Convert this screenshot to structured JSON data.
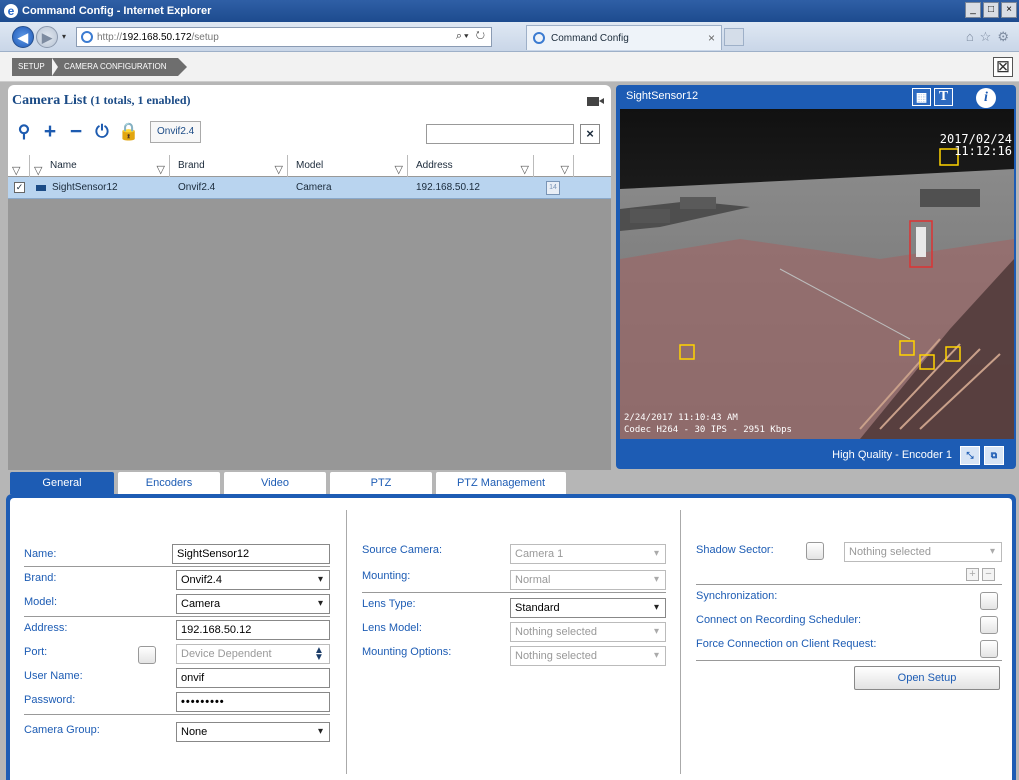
{
  "window": {
    "title": "Command Config - Internet Explorer",
    "controls": [
      "_",
      "□",
      "×"
    ]
  },
  "browser": {
    "url_proto": "http://",
    "url_host": "192.168.50.172",
    "url_path": "/setup",
    "url_controls": "⌕▾ ↻",
    "tab_title": "Command Config",
    "tab_close": "×",
    "nav_back": "◀",
    "nav_forward": "▶",
    "nav_dropdown": "▾",
    "right_icons": "⌂☆⚙"
  },
  "breadcrumb": {
    "items": [
      "SETUP",
      "CAMERA CONFIGURATION"
    ],
    "close": "⊠"
  },
  "camera_list": {
    "title": "Camera List",
    "subtitle": "(1 totals, 1 enabled)",
    "toolbar": {
      "search": "⚲",
      "add": "+",
      "remove": "−",
      "power": "⏻",
      "lock": "🔒"
    },
    "brand_chip": "Onvif2.4",
    "search_value": "",
    "clear": "×",
    "columns": [
      "Name",
      "Brand",
      "Model",
      "Address",
      ""
    ],
    "filter_glyph": "▽",
    "rows": [
      {
        "checked": "✓",
        "name": "SightSensor12",
        "brand": "Onvif2.4",
        "model": "Camera",
        "address": "192.168.50.12",
        "schedule": "14"
      }
    ]
  },
  "video": {
    "title": "SightSensor12",
    "btn_grid": "▦",
    "btn_text": "T",
    "btn_info": "i",
    "overlay_date": "2017/02/24",
    "overlay_time": "11:12:16",
    "timestamp": "2/24/2017 11:10:43 AM",
    "codec": "Codec H264 - 30 IPS - 2951 Kbps",
    "quality": "High Quality - Encoder 1",
    "btn_f1": "⤡",
    "btn_f2": "⧉"
  },
  "tabs": {
    "items": [
      "General",
      "Encoders",
      "Video",
      "PTZ",
      "PTZ Management"
    ],
    "active_index": 0
  },
  "general": {
    "name_label": "Name:",
    "name_value": "SightSensor12",
    "brand_label": "Brand:",
    "brand_value": "Onvif2.4",
    "model_label": "Model:",
    "model_value": "Camera",
    "address_label": "Address:",
    "address_value": "192.168.50.12",
    "port_label": "Port:",
    "port_placeholder": "Device Dependent",
    "username_label": "User Name:",
    "username_value": "onvif",
    "password_label": "Password:",
    "password_value": "•••••••••",
    "group_label": "Camera Group:",
    "group_value": "None",
    "source_camera_label": "Source Camera:",
    "source_camera_value": "Camera 1",
    "mounting_label": "Mounting:",
    "mounting_value": "Normal",
    "lens_type_label": "Lens Type:",
    "lens_type_value": "Standard",
    "lens_model_label": "Lens Model:",
    "lens_model_value": "Nothing selected",
    "mounting_options_label": "Mounting Options:",
    "mounting_options_value": "Nothing selected",
    "shadow_sector_label": "Shadow Sector:",
    "shadow_sector_value": "Nothing selected",
    "sync_label": "Synchronization:",
    "connect_sched_label": "Connect on Recording Scheduler:",
    "force_conn_label": "Force Connection on Client Request:",
    "open_setup_label": "Open Setup",
    "plus": "+",
    "minus": "−"
  }
}
